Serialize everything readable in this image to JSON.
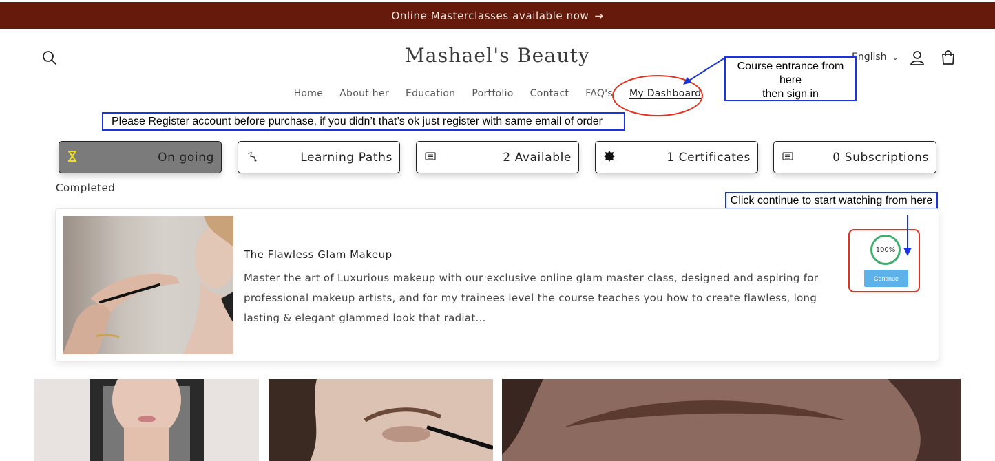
{
  "announcement": {
    "text": "Online Masterclasses available now",
    "arrow": "→"
  },
  "header": {
    "brand": "Mashael's Beauty",
    "language": "English",
    "search_icon": "search-icon",
    "account_icon": "account-icon",
    "cart_icon": "cart-icon"
  },
  "nav": {
    "items": [
      "Home",
      "About her",
      "Education",
      "Portfolio",
      "Contact",
      "FAQ's",
      "My Dashboard"
    ],
    "active": "My Dashboard"
  },
  "annotations": {
    "course_entrance": [
      "Course entrance from",
      "here",
      "then sign in"
    ],
    "register_note": "Please Register account before purchase, if you didn’t that’s ok just register with same email of order",
    "continue_hint": "Click continue to start watching from here"
  },
  "stats": [
    {
      "label": "On going",
      "icon": "hourglass-icon"
    },
    {
      "label": "Learning Paths",
      "icon": "path-icon"
    },
    {
      "label": "2 Available",
      "icon": "list-icon"
    },
    {
      "label": "1 Certificates",
      "icon": "badge-icon"
    },
    {
      "label": "0 Subscriptions",
      "icon": "list-icon"
    }
  ],
  "completed_label": "Completed",
  "course": {
    "title": "The Flawless Glam Makeup",
    "description": "Master the art of Luxurious makeup with our exclusive online glam master class, designed and aspiring for professional makeup artists, and for my trainees level the course teaches you how to create flawless, long lasting & elegant glammed look that radiat...",
    "progress": "100%",
    "progress_fraction": 1.0,
    "continue_label": "Continue"
  },
  "colors": {
    "announcement_bg": "#651a0c",
    "annotation_blue": "#1734e0",
    "annotation_red": "#e5311d",
    "progress_green": "#3fae6c",
    "continue_blue": "#5db2ea",
    "active_tab_bg": "#7b7b7b"
  }
}
